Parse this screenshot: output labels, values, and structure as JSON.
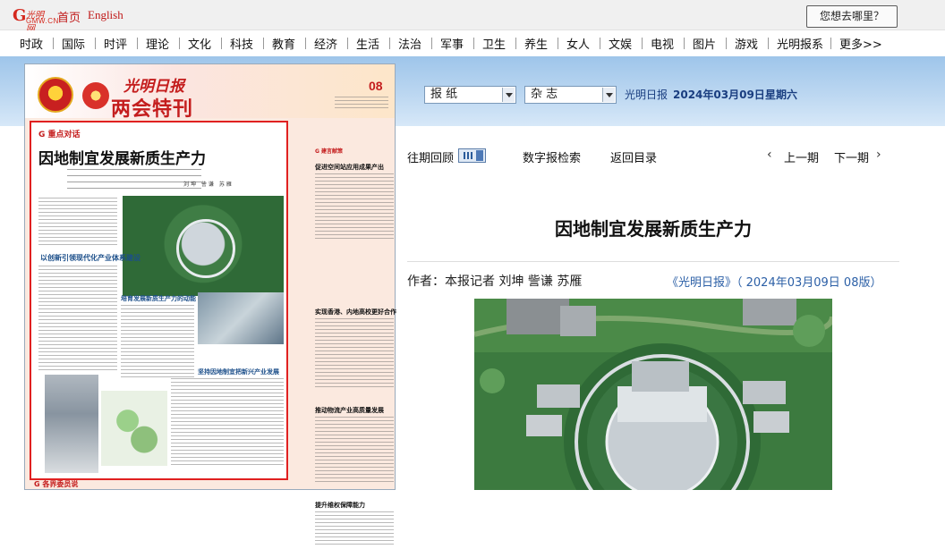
{
  "brand": {
    "logo_letter": "G",
    "logo_cn": "光明网",
    "logo_en": "GMW.CN"
  },
  "topbar": {
    "home": "首页",
    "english": "English",
    "where_button": "您想去哪里？"
  },
  "nav": [
    "时政",
    "国际",
    "时评",
    "理论",
    "文化",
    "科技",
    "教育",
    "经济",
    "生活",
    "法治",
    "军事",
    "卫生",
    "养生",
    "女人",
    "文娱",
    "电视",
    "图片",
    "游戏",
    "光明报系",
    "更多>>"
  ],
  "selectors": {
    "newspaper": "报  纸",
    "magazine": "杂  志"
  },
  "edition": {
    "paper_name": "光明日报",
    "date": "2024年03月09日",
    "weekday": "星期六"
  },
  "thumbnail": {
    "brand": "光明日报",
    "banner": "两会特刊",
    "page_no": "08",
    "tag": "G 重点对话",
    "headline": "因地制宜发展新质生产力",
    "byname": "刘坤 訾谦 苏雁",
    "subheads": [
      "以创新引领现代化产业体系建设",
      "培育发展新质生产力的动能",
      "坚持因地制宜把新兴产业发展"
    ],
    "right_tag": "G 建言献策",
    "right_heads": [
      "促进空间站应用成果产出",
      "实现香港、内地高校更好合作",
      "推动物流产业高质量发展",
      "提升维权保障能力"
    ],
    "footer": "G 各界委员说"
  },
  "controls": {
    "history": "往期回顾",
    "digital_search": "数字报检索",
    "back_to_contents": "返回目录",
    "prev": "上一期",
    "next": "下一期"
  },
  "article": {
    "title": "因地制宜发展新质生产力",
    "author": "作者：本报记者 刘坤 訾谦 苏雁",
    "source": "《光明日报》（ 2024年03月09日   08版）"
  }
}
